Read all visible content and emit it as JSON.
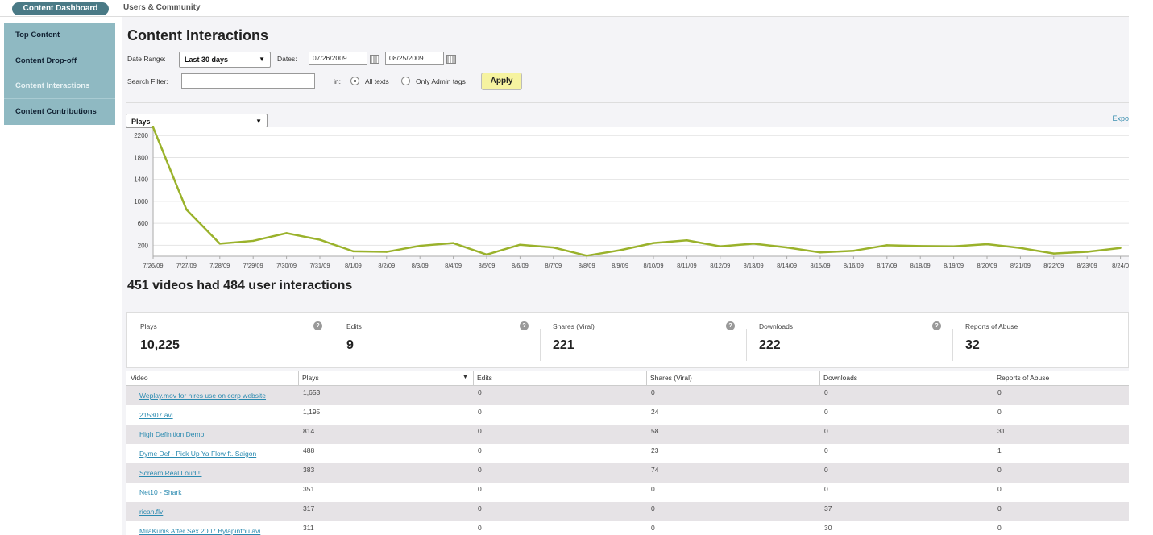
{
  "tabs": {
    "active": "Content Dashboard",
    "other": "Users & Community"
  },
  "sidebar": {
    "items": [
      {
        "label": "Top Content",
        "active": false
      },
      {
        "label": "Content Drop-off",
        "active": false
      },
      {
        "label": "Content Interactions",
        "active": true
      },
      {
        "label": "Content Contributions",
        "active": false
      }
    ]
  },
  "page": {
    "title": "Content Interactions",
    "date_range_label": "Date Range:",
    "date_range_value": "Last 30 days",
    "dates_label": "Dates:",
    "date_from": "07/26/2009",
    "date_to": "08/25/2009",
    "search_label": "Search Filter:",
    "search_value": "",
    "in_label": "in:",
    "radio_all": "All texts",
    "radio_admin": "Only Admin tags",
    "apply": "Apply",
    "metric_select": "Plays",
    "export_label": "Expo",
    "summary": "451 videos had 484 user interactions"
  },
  "colors": {
    "line": "#9ab22b",
    "accent": "#4a7a86",
    "sidebar": "#8fb9c2",
    "link": "#2a8ab0"
  },
  "chart_data": {
    "type": "line",
    "x": [
      "7/26/09",
      "7/27/09",
      "7/28/09",
      "7/29/09",
      "7/30/09",
      "7/31/09",
      "8/1/09",
      "8/2/09",
      "8/3/09",
      "8/4/09",
      "8/5/09",
      "8/6/09",
      "8/7/09",
      "8/8/09",
      "8/9/09",
      "8/10/09",
      "8/11/09",
      "8/12/09",
      "8/13/09",
      "8/14/09",
      "8/15/09",
      "8/16/09",
      "8/17/09",
      "8/18/09",
      "8/19/09",
      "8/20/09",
      "8/21/09",
      "8/22/09",
      "8/23/09",
      "8/24/0"
    ],
    "series": [
      {
        "values": [
          2350,
          850,
          230,
          280,
          420,
          300,
          90,
          80,
          190,
          240,
          30,
          210,
          160,
          10,
          110,
          240,
          290,
          180,
          230,
          160,
          70,
          100,
          200,
          185,
          180,
          220,
          150,
          50,
          80,
          150
        ]
      }
    ],
    "yticks": [
      200,
      600,
      1000,
      1400,
      1800,
      2200
    ],
    "ylim": [
      0,
      2350
    ],
    "grid": true
  },
  "stats": [
    {
      "label": "Plays",
      "value": "10,225"
    },
    {
      "label": "Edits",
      "value": "9"
    },
    {
      "label": "Shares (Viral)",
      "value": "221"
    },
    {
      "label": "Downloads",
      "value": "222"
    },
    {
      "label": "Reports of Abuse",
      "value": "32"
    }
  ],
  "table": {
    "headers": [
      "Video",
      "Plays",
      "Edits",
      "Shares (Viral)",
      "Downloads",
      "Reports of Abuse"
    ],
    "rows": [
      [
        "Weplay.mov for hires use on corp website",
        "1,653",
        "0",
        "0",
        "0",
        "0"
      ],
      [
        "215307.avi",
        "1,195",
        "0",
        "24",
        "0",
        "0"
      ],
      [
        "High Definition Demo",
        "814",
        "0",
        "58",
        "0",
        "31"
      ],
      [
        "Dyme Def - Pick Up Ya Flow ft. Saigon",
        "488",
        "0",
        "23",
        "0",
        "1"
      ],
      [
        "Scream Real Loud!!!",
        "383",
        "0",
        "74",
        "0",
        "0"
      ],
      [
        "Net10 - Shark",
        "351",
        "0",
        "0",
        "0",
        "0"
      ],
      [
        "rican.flv",
        "317",
        "0",
        "0",
        "37",
        "0"
      ],
      [
        "MilaKunis After Sex 2007 Bylapinfou.avi",
        "311",
        "0",
        "0",
        "30",
        "0"
      ]
    ]
  }
}
